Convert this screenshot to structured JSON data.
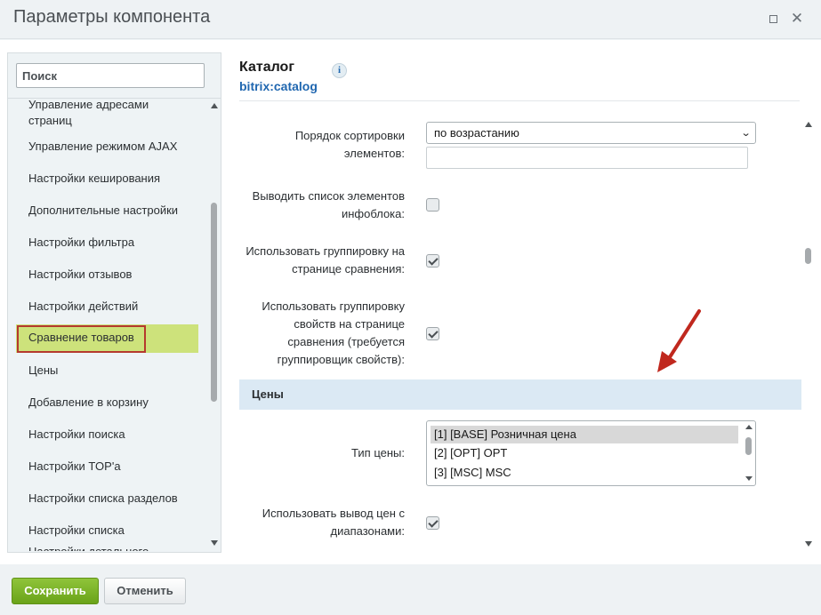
{
  "window": {
    "title": "Параметры компонента",
    "maximize_icon": "maximize-icon",
    "close_icon": "close-icon",
    "close_glyph": "✕"
  },
  "sidebar": {
    "search_placeholder": "Поиск",
    "items": [
      {
        "label": "Управление адресами страниц",
        "partial": true
      },
      {
        "label": "Управление режимом AJAX"
      },
      {
        "label": "Настройки кеширования"
      },
      {
        "label": "Дополнительные настройки"
      },
      {
        "label": "Настройки фильтра"
      },
      {
        "label": "Настройки отзывов"
      },
      {
        "label": "Настройки действий"
      },
      {
        "label": "Сравнение товаров",
        "active": true
      },
      {
        "label": "Цены"
      },
      {
        "label": "Добавление в корзину"
      },
      {
        "label": "Настройки поиска"
      },
      {
        "label": "Настройки TOP'a"
      },
      {
        "label": "Настройки списка разделов"
      },
      {
        "label": "Настройки списка"
      },
      {
        "label": "Настройки детального",
        "partial": true
      }
    ]
  },
  "component": {
    "title": "Каталог",
    "code": "bitrix:catalog",
    "info_icon": "info-icon",
    "info_glyph": "i"
  },
  "fields": {
    "sort_order": {
      "label_line1": "Порядок сортировки",
      "label_line2": "элементов:",
      "value": "по возрастанию",
      "extra_input_value": ""
    },
    "show_iblock_list": {
      "label_line1": "Выводить список элементов",
      "label_line2": "инфоблока:",
      "checked": false
    },
    "use_compare_grouping": {
      "label_line1": "Использовать группировку на",
      "label_line2": "странице сравнения:",
      "checked": true
    },
    "use_props_grouping": {
      "label_line1": "Использовать группировку",
      "label_line2": "свойств на странице",
      "label_line3": "сравнения (требуется",
      "label_line4": "группировщик свойств):",
      "checked": true
    }
  },
  "prices_section": {
    "title": "Цены",
    "price_type": {
      "label": "Тип цены:",
      "options": [
        {
          "label": "[1] [BASE] Розничная цена",
          "selected": true
        },
        {
          "label": "[2] [OPT] OPT"
        },
        {
          "label": "[3] [MSC] MSC"
        }
      ]
    },
    "use_price_ranges": {
      "label_line1": "Использовать вывод цен с",
      "label_line2": "диапазонами:",
      "checked": true
    }
  },
  "annotation": {
    "arrow_color": "#c0281e"
  },
  "footer": {
    "save_label": "Сохранить",
    "cancel_label": "Отменить"
  },
  "colors": {
    "accent_green": "#6aa319",
    "active_item_bg": "#cde27b",
    "active_item_border": "#b5392e",
    "link_blue": "#2067b0",
    "section_bg": "#dbe9f4"
  }
}
